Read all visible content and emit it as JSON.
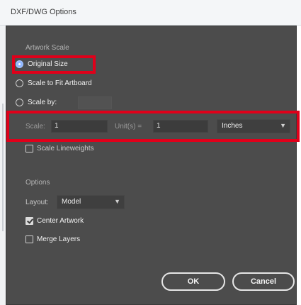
{
  "window": {
    "title": "DXF/DWG Options"
  },
  "artwork_scale": {
    "group_label": "Artwork Scale",
    "options": [
      {
        "label": "Original Size",
        "checked": true
      },
      {
        "label": "Scale to Fit Artboard",
        "checked": false
      },
      {
        "label": "Scale by:",
        "checked": false
      }
    ],
    "scale_row": {
      "scale_label": "Scale:",
      "scale_value": "1",
      "units_label": "Unit(s) =",
      "units_value": "1",
      "unit_select": "Inches"
    },
    "scale_lineweights": {
      "label": "Scale Lineweights",
      "checked": false
    }
  },
  "options": {
    "group_label": "Options",
    "layout_label": "Layout:",
    "layout_value": "Model",
    "center_artwork": {
      "label": "Center Artwork",
      "checked": true
    },
    "merge_layers": {
      "label": "Merge Layers",
      "checked": false
    }
  },
  "buttons": {
    "ok": "OK",
    "cancel": "Cancel"
  },
  "colors": {
    "highlight": "#e0001a",
    "dialog_bg": "#4c4c4c",
    "radio_selected": "#8fb6ff"
  }
}
